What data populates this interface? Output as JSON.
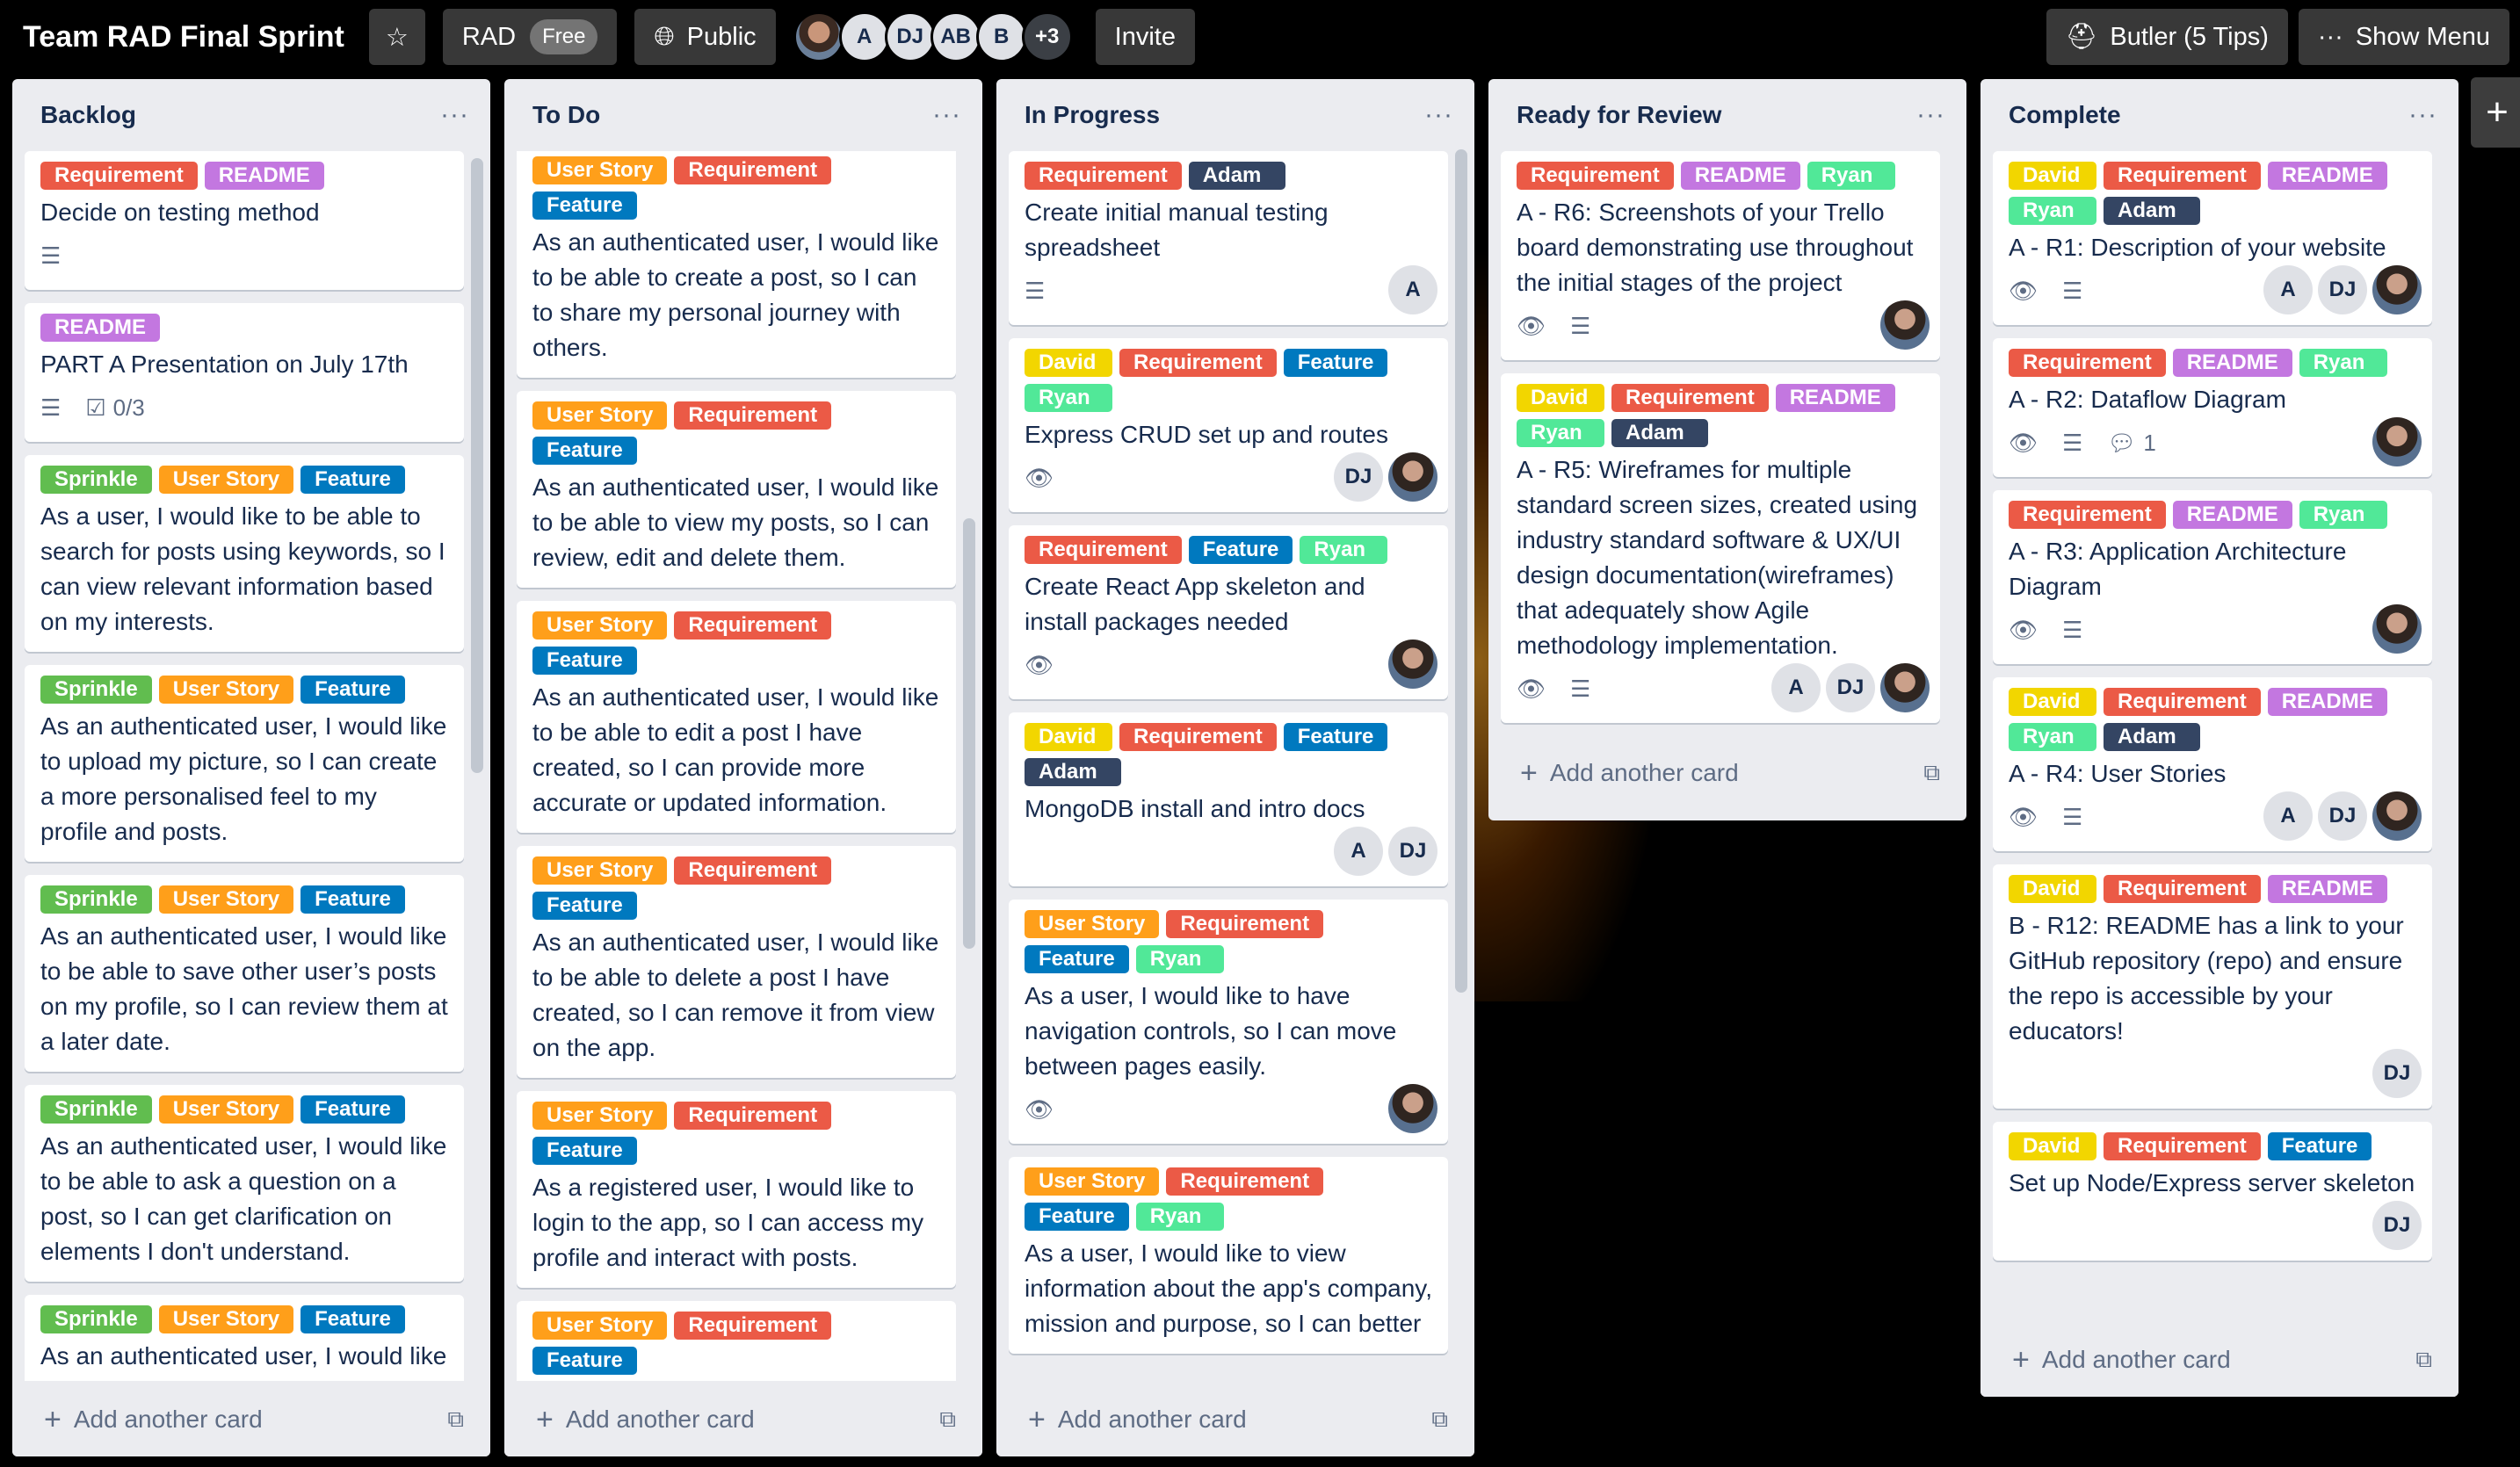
{
  "board": {
    "title": "Team RAD Final Sprint",
    "star_icon": "star-icon",
    "workspace": "RAD",
    "workspace_plan": "Free",
    "visibility": "Public",
    "visibility_icon": "globe-icon",
    "members": [
      "A",
      "DJ",
      "AB",
      "B"
    ],
    "members_more": "+3",
    "invite": "Invite",
    "butler": "Butler (5 Tips)",
    "show_menu": "Show Menu",
    "add_list_icon": "plus-icon"
  },
  "colors": {
    "Requirement": "#eb5a46",
    "README": "#c377e0",
    "User Story": "#ff9f1a",
    "Feature": "#0079bf",
    "Sprinkle": "#61bd4f",
    "David": "#f2d600",
    "Ryan": "#51e898",
    "Adam": "#344563"
  },
  "add_card": "Add another card",
  "lists": [
    {
      "title": "Backlog",
      "cards": [
        {
          "labels": [
            "Requirement",
            "README"
          ],
          "title": "Decide on testing method",
          "desc": true
        },
        {
          "labels": [
            "README"
          ],
          "title": "PART A Presentation on July 17th",
          "desc": true,
          "checklist": "0/3"
        },
        {
          "labels": [
            "Sprinkle",
            "User Story",
            "Feature"
          ],
          "title": "As a user, I would like to be able to search for posts using keywords, so I can view relevant information based on my interests."
        },
        {
          "labels": [
            "Sprinkle",
            "User Story",
            "Feature"
          ],
          "title": "As an authenticated user, I would like to upload my picture, so I can create a more personalised feel to my profile and posts."
        },
        {
          "labels": [
            "Sprinkle",
            "User Story",
            "Feature"
          ],
          "title": "As an authenticated user, I would like to be able to save other user’s posts on my profile, so I can review them at a later date."
        },
        {
          "labels": [
            "Sprinkle",
            "User Story",
            "Feature"
          ],
          "title": "As an authenticated user, I would like to be able to ask a question on a post, so I can get clarification on elements I don't understand."
        },
        {
          "labels": [
            "Sprinkle",
            "User Story",
            "Feature"
          ],
          "title": "As an authenticated user, I would like"
        }
      ]
    },
    {
      "title": "To Do",
      "cards": [
        {
          "labels": [
            "User Story",
            "Requirement",
            "Feature"
          ],
          "title": "As an authenticated user, I would like to be able to create a post, so I can to share my personal journey with others."
        },
        {
          "labels": [
            "User Story",
            "Requirement",
            "Feature"
          ],
          "title": "As an authenticated user, I would like to be able to view my posts, so I can review, edit and delete them."
        },
        {
          "labels": [
            "User Story",
            "Requirement",
            "Feature"
          ],
          "title": "As an authenticated user, I would like to be able to edit a post I have created, so I can provide more accurate or updated information."
        },
        {
          "labels": [
            "User Story",
            "Requirement",
            "Feature"
          ],
          "title": "As an authenticated user, I would like to be able to delete a post I have created, so I can remove it from view on the app."
        },
        {
          "labels": [
            "User Story",
            "Requirement",
            "Feature"
          ],
          "title": "As a registered user, I would like to login to the app, so I can access my profile and interact with posts."
        },
        {
          "labels": [
            "User Story",
            "Requirement",
            "Feature"
          ],
          "title": ""
        }
      ]
    },
    {
      "title": "In Progress",
      "cards": [
        {
          "labels": [
            "Requirement",
            "Adam"
          ],
          "title": "Create initial manual testing spreadsheet",
          "desc": true,
          "members": [
            "A"
          ]
        },
        {
          "labels": [
            "David",
            "Requirement",
            "Feature",
            "Ryan"
          ],
          "title": "Express CRUD set up and routes",
          "watch": true,
          "members": [
            "DJ",
            "photo"
          ]
        },
        {
          "labels": [
            "Requirement",
            "Feature",
            "Ryan"
          ],
          "title": "Create React App skeleton and install packages needed",
          "watch": true,
          "members": [
            "photo"
          ]
        },
        {
          "labels": [
            "David",
            "Requirement",
            "Feature",
            "Adam"
          ],
          "title": "MongoDB install and intro docs",
          "members": [
            "A",
            "DJ"
          ]
        },
        {
          "labels": [
            "User Story",
            "Requirement",
            "Feature",
            "Ryan"
          ],
          "title": "As a user, I would like to have navigation controls, so I can move between pages easily.",
          "watch": true,
          "members": [
            "photo"
          ]
        },
        {
          "labels": [
            "User Story",
            "Requirement",
            "Feature",
            "Ryan"
          ],
          "title": "As a user, I would like to view information about the app's company, mission and purpose, so I can better"
        }
      ]
    },
    {
      "title": "Ready for Review",
      "cards": [
        {
          "labels": [
            "Requirement",
            "README",
            "Ryan"
          ],
          "title": "A - R6: Screenshots of your Trello board demonstrating use throughout the initial stages of the project",
          "watch": true,
          "desc": true,
          "members": [
            "photo"
          ]
        },
        {
          "labels": [
            "David",
            "Requirement",
            "README",
            "Ryan",
            "Adam"
          ],
          "title": "A - R5: Wireframes for multiple standard screen sizes, created using industry standard software & UX/UI design documentation(wireframes) that adequately show Agile methodology implementation.",
          "watch": true,
          "desc": true,
          "members": [
            "A",
            "DJ",
            "photo"
          ]
        }
      ]
    },
    {
      "title": "Complete",
      "cards": [
        {
          "labels": [
            "David",
            "Requirement",
            "README",
            "Ryan",
            "Adam"
          ],
          "title": "A - R1: Description of your website",
          "watch": true,
          "desc": true,
          "members": [
            "A",
            "DJ",
            "photo"
          ]
        },
        {
          "labels": [
            "Requirement",
            "README",
            "Ryan"
          ],
          "title": "A - R2: Dataflow Diagram",
          "watch": true,
          "desc": true,
          "comments": "1",
          "members": [
            "photo"
          ]
        },
        {
          "labels": [
            "Requirement",
            "README",
            "Ryan"
          ],
          "title": "A - R3: Application Architecture Diagram",
          "watch": true,
          "desc": true,
          "members": [
            "photo"
          ]
        },
        {
          "labels": [
            "David",
            "Requirement",
            "README",
            "Ryan",
            "Adam"
          ],
          "title": "A - R4: User Stories",
          "watch": true,
          "desc": true,
          "members": [
            "A",
            "DJ",
            "photo"
          ]
        },
        {
          "labels": [
            "David",
            "Requirement",
            "README"
          ],
          "title": "B - R12: README has a link to your GitHub repository (repo) and ensure the repo is accessible by your educators!",
          "members": [
            "DJ"
          ]
        },
        {
          "labels": [
            "David",
            "Requirement",
            "Feature"
          ],
          "title": "Set up Node/Express server skeleton",
          "members": [
            "DJ"
          ]
        }
      ]
    }
  ]
}
